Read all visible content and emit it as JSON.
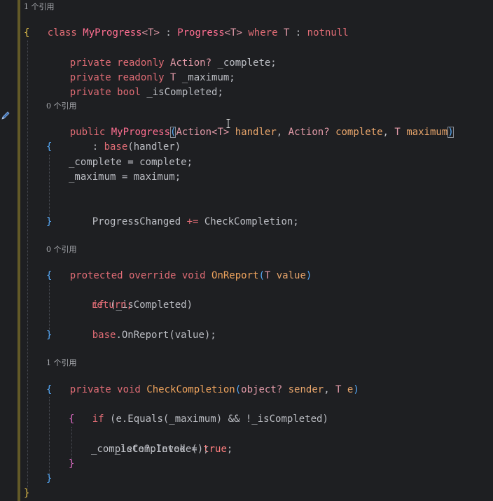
{
  "editor": {
    "language": "C#",
    "hints": {
      "class_refs": "1 个引用",
      "ctor_refs": "0 个引用",
      "onreport_refs": "0 个引用",
      "check_refs": "1 个引用"
    },
    "lines": {
      "class_decl": {
        "kw_class": "class ",
        "name": "MyProgress",
        "t1": "<T>",
        "colon": " : ",
        "base": "Progress",
        "t2": "<T>",
        "where": " where ",
        "tparam": "T",
        "colon2": " : ",
        "notnull": "notnull"
      },
      "open_class": "{",
      "field1": {
        "mods": "private readonly ",
        "type": "Action? ",
        "name": "_complete;"
      },
      "field2": {
        "mods": "private readonly ",
        "type": "T ",
        "name": "_maximum;"
      },
      "field3": {
        "mods": "private ",
        "type": "bool ",
        "name": "_isCompleted;"
      },
      "ctor": {
        "mod": "public ",
        "name": "MyProgress",
        "open": "(",
        "p1type": "Action<T> ",
        "p1name": "handler",
        "sep1": ", ",
        "p2type": "Action? ",
        "p2name": "complete",
        "sep2": ", ",
        "p3type": "T ",
        "p3name": "maximum",
        "close": ")"
      },
      "ctor_base": {
        "colon": ": ",
        "base": "base",
        "args": "(handler)"
      },
      "ctor_open": "{",
      "ctor_s1": "_complete = complete;",
      "ctor_s2": "_maximum = maximum;",
      "ctor_s3": {
        "name": "ProgressChanged ",
        "op": "+= ",
        "rhs": "CheckCompletion;"
      },
      "ctor_close": "}",
      "onreport": {
        "mods": "protected override void ",
        "name": "OnReport",
        "open": "(",
        "ptype": "T ",
        "pname": "value",
        "close": ")"
      },
      "or_open": "{",
      "or_if": {
        "kw": "if ",
        "cond": "(_isCompleted)"
      },
      "or_return": "return;",
      "or_base": {
        "base": "base",
        "dot": ".",
        "call": "OnReport",
        "args": "(value);"
      },
      "or_close": "}",
      "check": {
        "mods": "private void ",
        "name": "CheckCompletion",
        "open": "(",
        "p1type": "object? ",
        "p1name": "sender",
        "sep": ", ",
        "p2type": "T ",
        "p2name": "e",
        "close": ")"
      },
      "ck_open": "{",
      "ck_if": {
        "kw": "if ",
        "cond": "(e.Equals(_maximum) && !_isCompleted)"
      },
      "ck_inner_open": "{",
      "ck_s1": {
        "lhs": "_isCompleted = ",
        "val": "true",
        "end": ";"
      },
      "ck_s2": "_complete?.Invoke();",
      "ck_inner_close": "}",
      "ck_close": "}",
      "close_class": "}"
    }
  },
  "icons": {
    "gutter_action": "pen-icon",
    "mouse_cursor": "ibeam-cursor-icon"
  },
  "colors": {
    "background": "#1e1f22",
    "keyword": "#e06c75",
    "method": "#f0a45d",
    "class_name": "#ff6f91",
    "plain": "#bcbec4",
    "gutter_marker": "#9c8b2e"
  }
}
